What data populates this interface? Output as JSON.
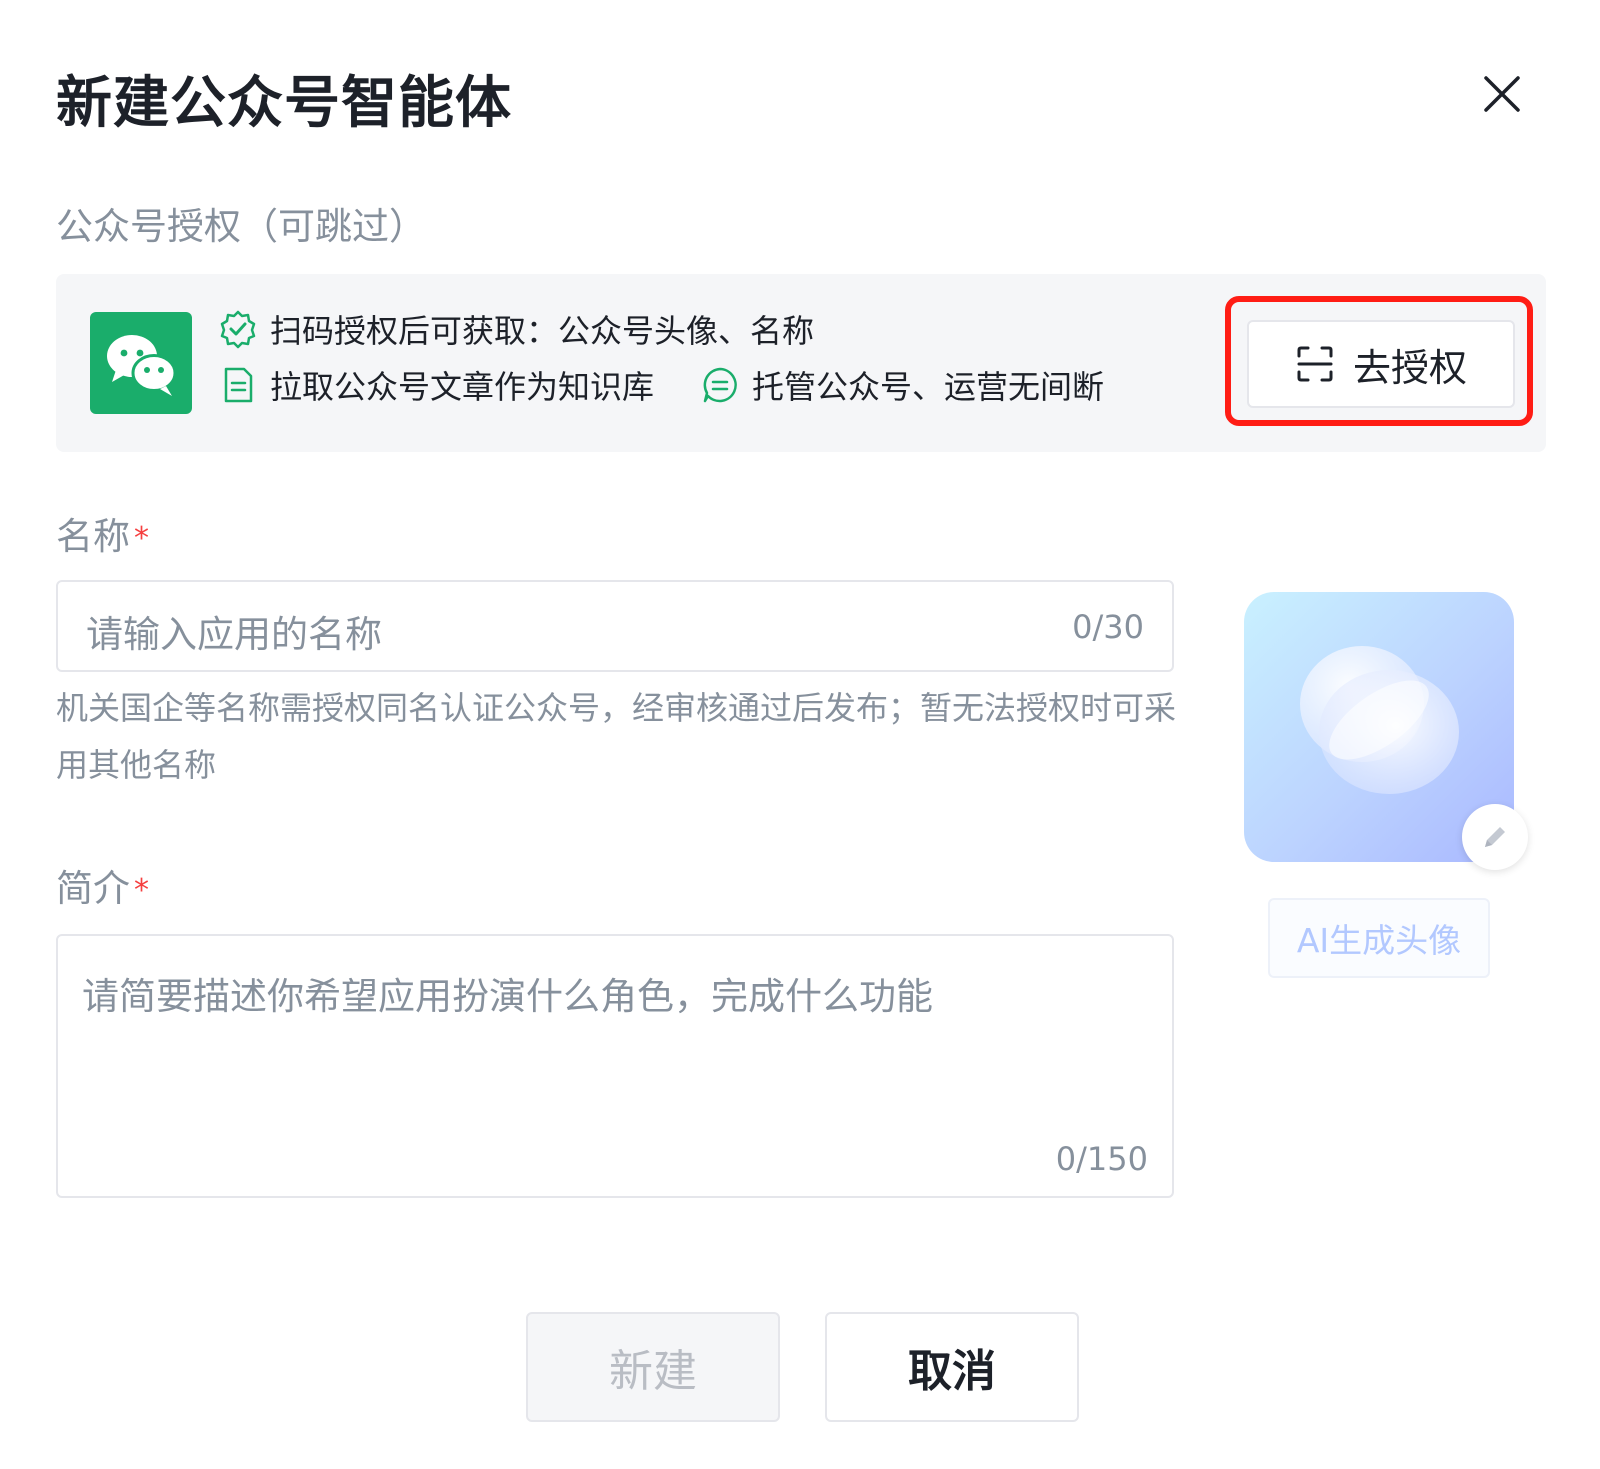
{
  "dialog": {
    "title": "新建公众号智能体"
  },
  "auth_section": {
    "label": "公众号授权（可跳过）",
    "features": [
      "扫码授权后可获取：公众号头像、名称",
      "拉取公众号文章作为知识库",
      "托管公众号、运营无间断"
    ],
    "button_label": "去授权",
    "icons": [
      "wechat-logo",
      "verified-check-icon",
      "document-icon",
      "chat-bubble-icon",
      "scan-icon"
    ],
    "accent_color": "#1aad6b",
    "highlight_color": "#ff1d15"
  },
  "name_field": {
    "label": "名称",
    "required_mark": "*",
    "placeholder": "请输入应用的名称",
    "counter": "0/30",
    "hint": "机关国企等名称需授权同名认证公众号，经审核通过后发布；暂无法授权时可采用其他名称"
  },
  "intro_field": {
    "label": "简介",
    "required_mark": "*",
    "placeholder": "请简要描述你希望应用扮演什么角色，完成什么功能",
    "counter": "0/150"
  },
  "avatar": {
    "ai_button_label": "AI生成头像",
    "edit_icon": "pencil-icon"
  },
  "footer": {
    "create_label": "新建",
    "cancel_label": "取消"
  }
}
